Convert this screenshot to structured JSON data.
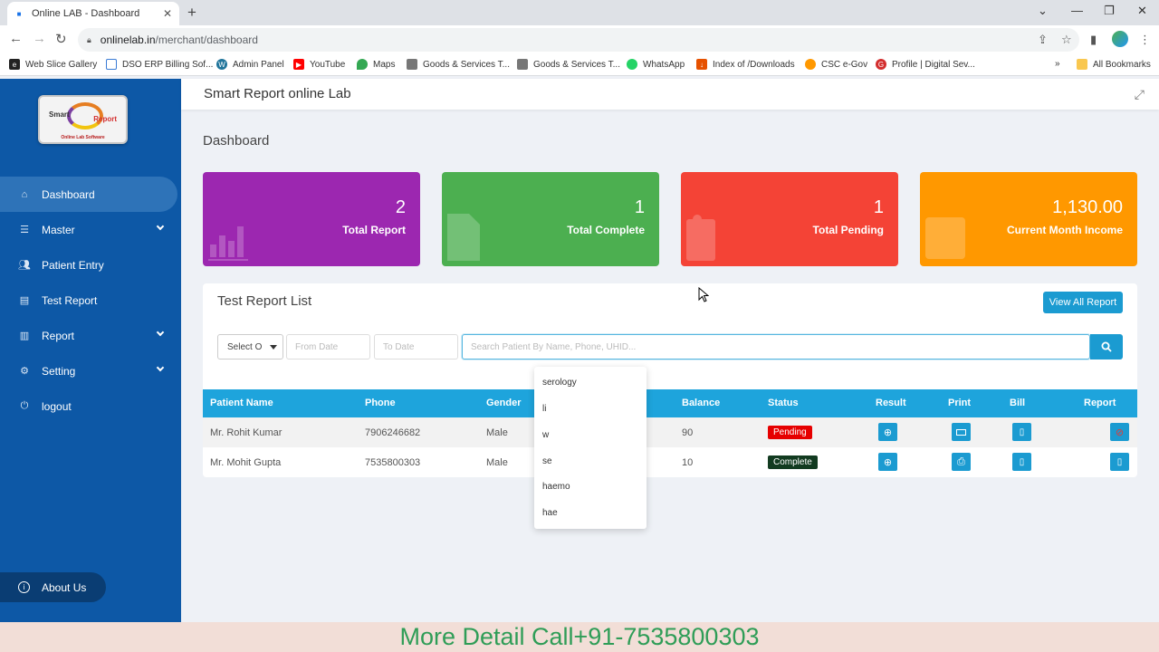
{
  "browser": {
    "tab_title": "Online LAB - Dashboard",
    "url_host": "onlinelab.in",
    "url_path": "/merchant/dashboard",
    "bookmarks": [
      "Web Slice Gallery",
      "DSO ERP Billing Sof...",
      "Admin Panel",
      "YouTube",
      "Maps",
      "Goods & Services T...",
      "Goods & Services T...",
      "WhatsApp",
      "Index of /Downloads",
      "CSC e-Gov",
      "Profile | Digital Sev..."
    ],
    "all_bookmarks": "All Bookmarks",
    "more_chevron": "»"
  },
  "logo": {
    "word1": "Smart",
    "word2": "Report",
    "tagline": "Online Lab Software"
  },
  "sidebar": {
    "items": [
      "Dashboard",
      "Master",
      "Patient Entry",
      "Test Report",
      "Report",
      "Setting",
      "logout"
    ],
    "about": "About Us"
  },
  "header": {
    "brand": "Smart Report online Lab"
  },
  "page": {
    "title": "Dashboard"
  },
  "cards": [
    {
      "value": "2",
      "label": "Total Report",
      "color": "#9c27b0"
    },
    {
      "value": "1",
      "label": "Total Complete",
      "color": "#4caf50"
    },
    {
      "value": "1",
      "label": "Total Pending",
      "color": "#f44336"
    },
    {
      "value": "1,130.00",
      "label": "Current Month Income",
      "color": "#ff9800"
    }
  ],
  "report_list": {
    "title": "Test Report List",
    "view_all": "View All Report",
    "select_value": "Select O",
    "from_placeholder": "From Date",
    "to_placeholder": "To Date",
    "search_placeholder": "Search Patient By Name, Phone, UHID..."
  },
  "table": {
    "headers": [
      "Patient Name",
      "Phone",
      "Gender",
      "Balance",
      "Status",
      "Result",
      "Print",
      "Bill",
      "Report"
    ],
    "rows": [
      {
        "name": "Mr. Rohit Kumar",
        "phone": "7906246682",
        "gender": "Male",
        "balance": "90",
        "status": "Pending"
      },
      {
        "name": "Mr. Mohit Gupta",
        "phone": "7535800303",
        "gender": "Male",
        "balance": "10",
        "status": "Complete"
      }
    ]
  },
  "autocomplete": [
    "serology",
    "li",
    "w",
    "se",
    "haemo",
    "hae"
  ],
  "footer_banner": "More Detail Call+91-7535800303"
}
